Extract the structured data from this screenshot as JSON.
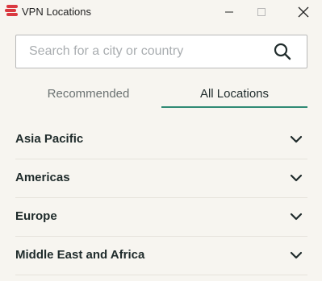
{
  "window": {
    "title": "VPN Locations",
    "logo_color": "#da3940"
  },
  "search": {
    "placeholder": "Search for a city or country",
    "value": "",
    "icon": "search-icon"
  },
  "tabs": [
    {
      "label": "Recommended",
      "selected": false
    },
    {
      "label": "All Locations",
      "selected": true
    }
  ],
  "accent_color": "#2f8a74",
  "regions": [
    {
      "name": "Asia Pacific",
      "icon": "chevron-down-icon"
    },
    {
      "name": "Americas",
      "icon": "chevron-down-icon"
    },
    {
      "name": "Europe",
      "icon": "chevron-down-icon"
    },
    {
      "name": "Middle East and Africa",
      "icon": "chevron-down-icon"
    }
  ]
}
